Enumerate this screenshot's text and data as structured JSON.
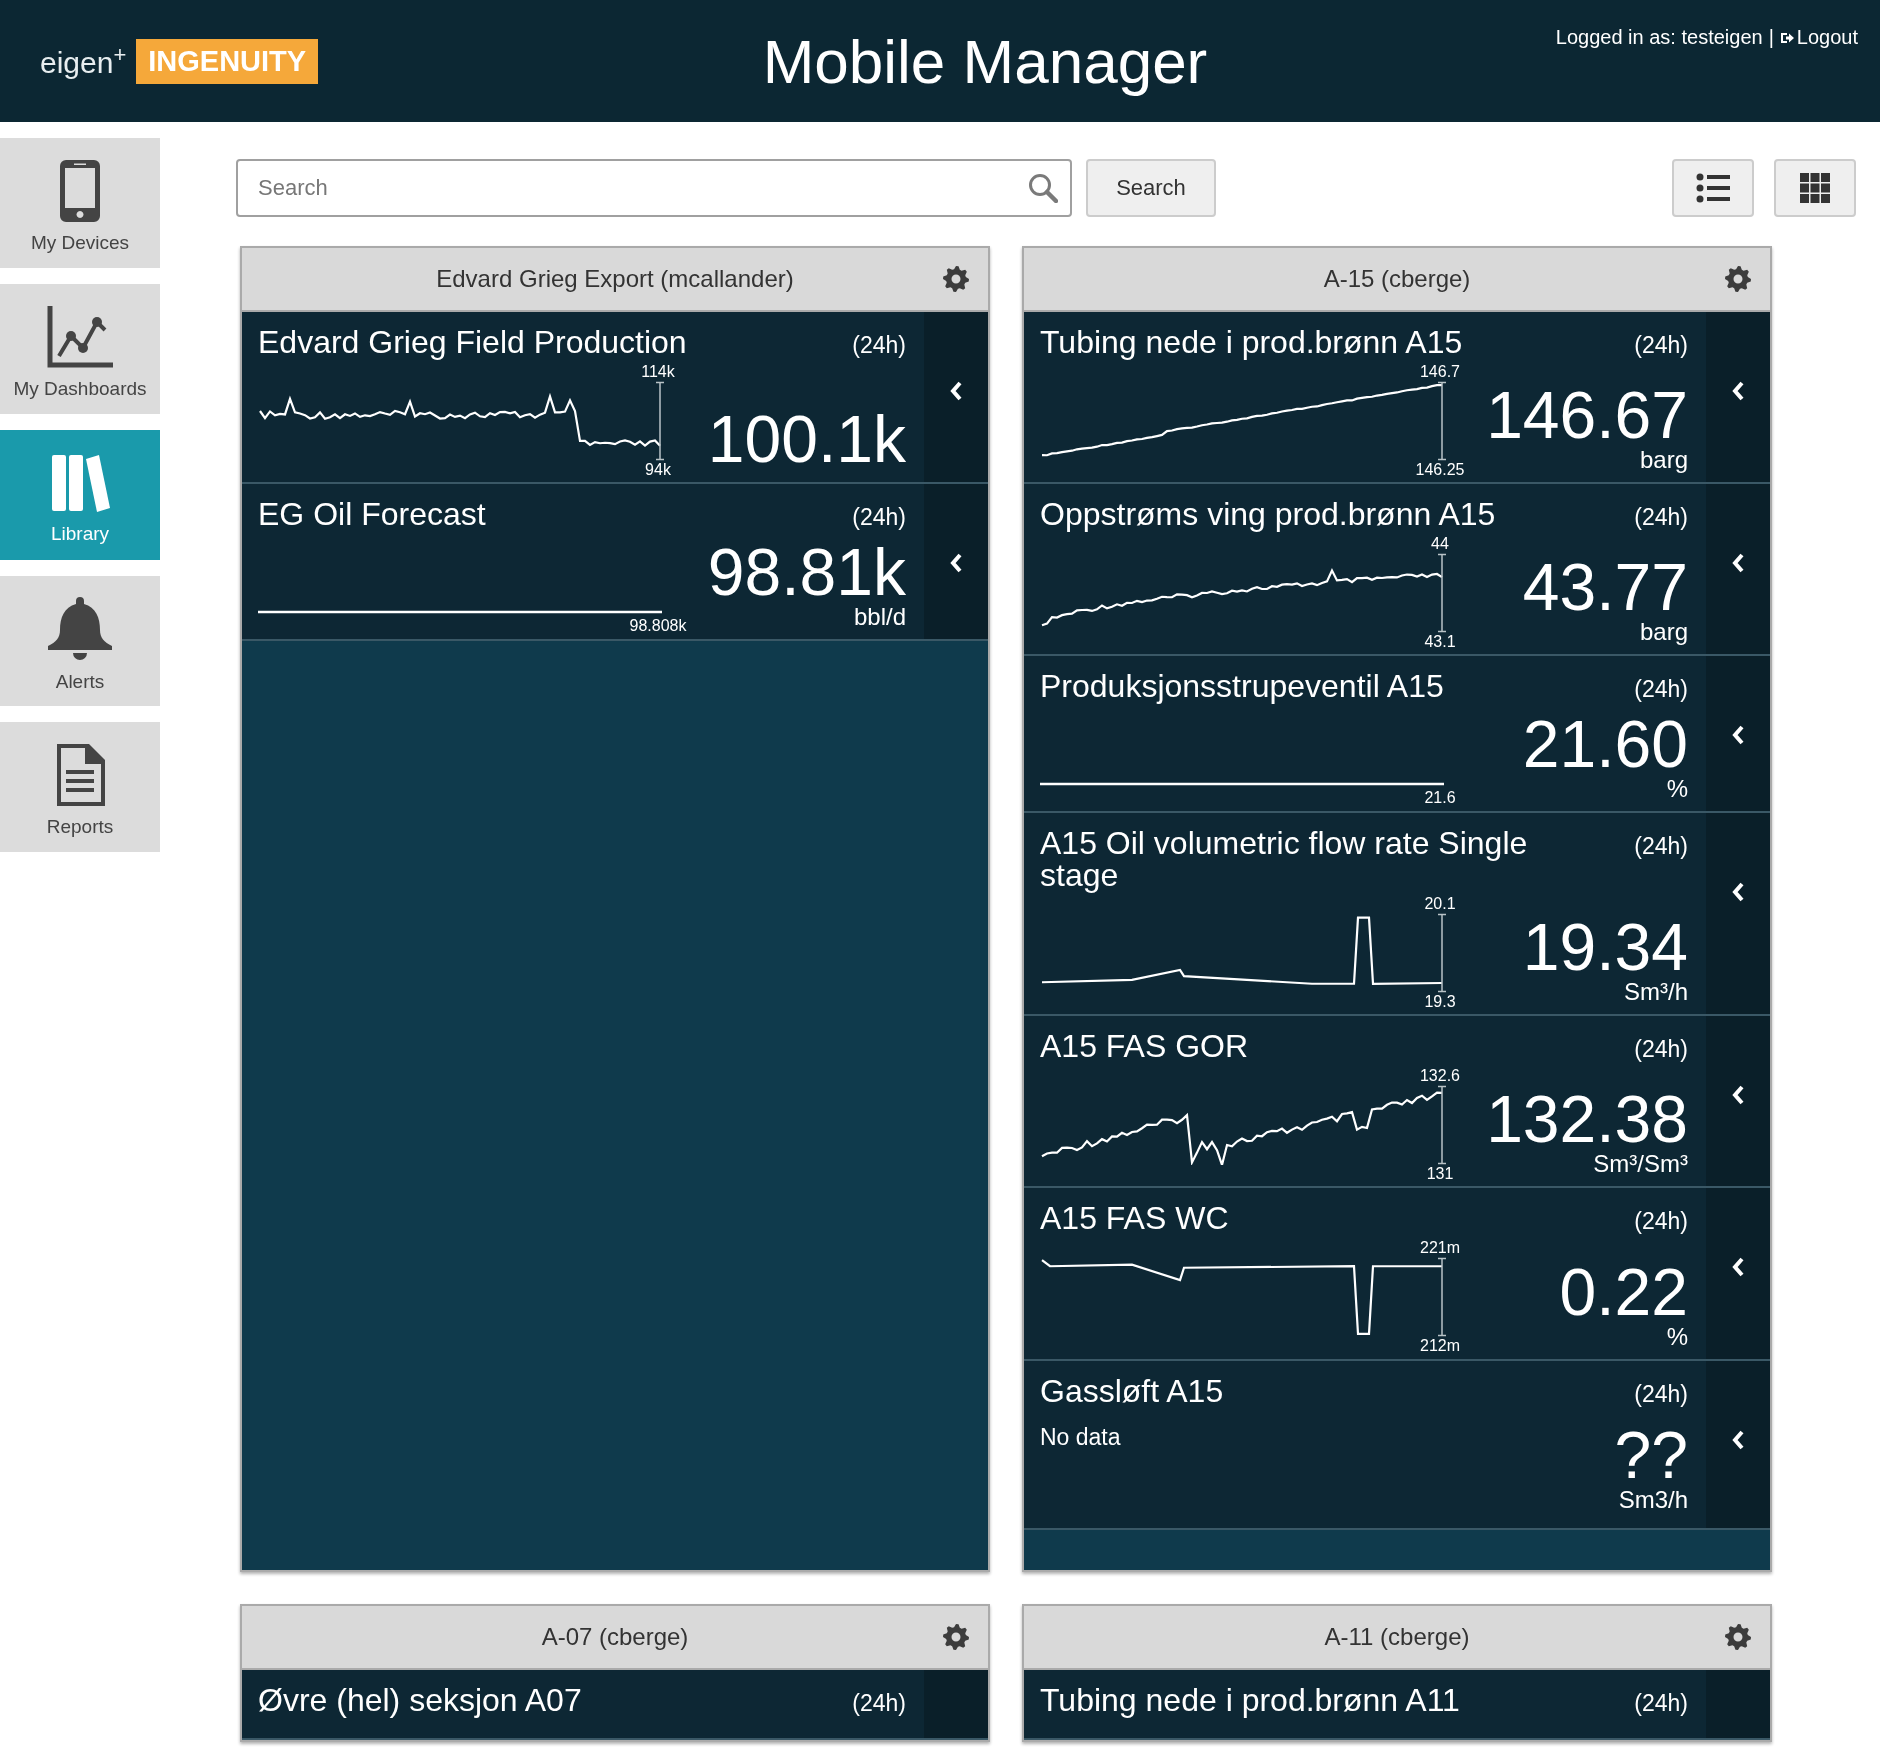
{
  "header": {
    "logo": {
      "brand": "eigen",
      "mark": "+",
      "product": "INGENUITY"
    },
    "title": "Mobile Manager",
    "user": {
      "logged_in": "Logged in as: testeigen",
      "separator": "|",
      "logout": "Logout"
    }
  },
  "sidebar": {
    "items": [
      {
        "label": "My Devices",
        "selected": false
      },
      {
        "label": "My Dashboards",
        "selected": false
      },
      {
        "label": "Library",
        "selected": true
      },
      {
        "label": "Alerts",
        "selected": false
      },
      {
        "label": "Reports",
        "selected": false
      }
    ]
  },
  "toolbar": {
    "search": {
      "placeholder": "Search"
    },
    "search_button": "Search"
  },
  "cards": [
    {
      "title": "Edvard Grieg Export (mcallander)",
      "tiles": [
        {
          "kind": "chart",
          "title": "Edvard Grieg Field Production",
          "period": "(24h)",
          "max_label": "114k",
          "min_label": "94k",
          "value": "100.1k"
        },
        {
          "kind": "flat",
          "title": "EG Oil Forecast",
          "period": "(24h)",
          "label": "98.808k",
          "value": "98.81k",
          "unit": "bbl/d"
        }
      ]
    },
    {
      "title": "A-15 (cberge)",
      "tiles": [
        {
          "kind": "chart",
          "title": "Tubing nede i prod.brønn A15",
          "period": "(24h)",
          "max_label": "146.7",
          "min_label": "146.25",
          "value": "146.67",
          "unit": "barg"
        },
        {
          "kind": "chart",
          "title": "Oppstrøms ving prod.brønn A15",
          "period": "(24h)",
          "max_label": "44",
          "min_label": "43.1",
          "value": "43.77",
          "unit": "barg"
        },
        {
          "kind": "flat",
          "title": "Produksjonsstrupeventil A15",
          "period": "(24h)",
          "label": "21.6",
          "value": "21.60",
          "unit": "%"
        },
        {
          "kind": "chart",
          "title": "A15 Oil volumetric flow rate Single stage",
          "period": "(24h)",
          "max_label": "20.1",
          "min_label": "19.3",
          "value": "19.34",
          "unit": "Sm³/h"
        },
        {
          "kind": "chart",
          "title": "A15 FAS GOR",
          "period": "(24h)",
          "max_label": "132.6",
          "min_label": "131",
          "value": "132.38",
          "unit": "Sm³/Sm³"
        },
        {
          "kind": "chart",
          "title": "A15 FAS WC",
          "period": "(24h)",
          "max_label": "221m",
          "min_label": "212m",
          "value": "0.22",
          "unit": "%"
        },
        {
          "kind": "no_data",
          "title": "Gassløft A15",
          "period": "(24h)",
          "message": "No data",
          "value": "??",
          "unit": "Sm3/h"
        }
      ]
    },
    {
      "title": "A-07 (cberge)",
      "tiles": [
        {
          "kind": "cut",
          "title": "Øvre (hel) seksjon A07",
          "period": "(24h)"
        }
      ]
    },
    {
      "title": "A-11 (cberge)",
      "tiles": [
        {
          "kind": "cut",
          "title": "Tubing nede i prod.brønn A11",
          "period": "(24h)"
        }
      ]
    }
  ]
}
